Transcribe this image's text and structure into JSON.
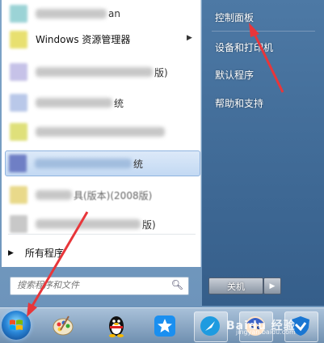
{
  "programs": {
    "item0_suffix": "an",
    "explorer_label": "Windows 资源管理器",
    "item2_suffix": "版)",
    "item3_suffix": "统",
    "item5_suffix": "统",
    "item6_suffix": "具(版本)(2008版)",
    "item7_suffix": "版)",
    "all_programs": "所有程序"
  },
  "search": {
    "placeholder": "搜索程序和文件"
  },
  "right_pane": {
    "items": [
      {
        "label": "控制面板"
      },
      {
        "label": "设备和打印机"
      },
      {
        "label": "默认程序"
      },
      {
        "label": "帮助和支持"
      }
    ],
    "shutdown_label": "关机"
  },
  "watermark": {
    "brand": "Baidu 经验",
    "url": "jingyan.baidu.com"
  },
  "colors": {
    "annotation_arrow": "#e8363a",
    "highlight": "#c3d9f3"
  },
  "icons": [
    "windows-start-orb",
    "paint-icon",
    "qq-penguin-icon",
    "star-app-icon",
    "browser-icon",
    "anime-avatar-icon",
    "shield-icon"
  ]
}
